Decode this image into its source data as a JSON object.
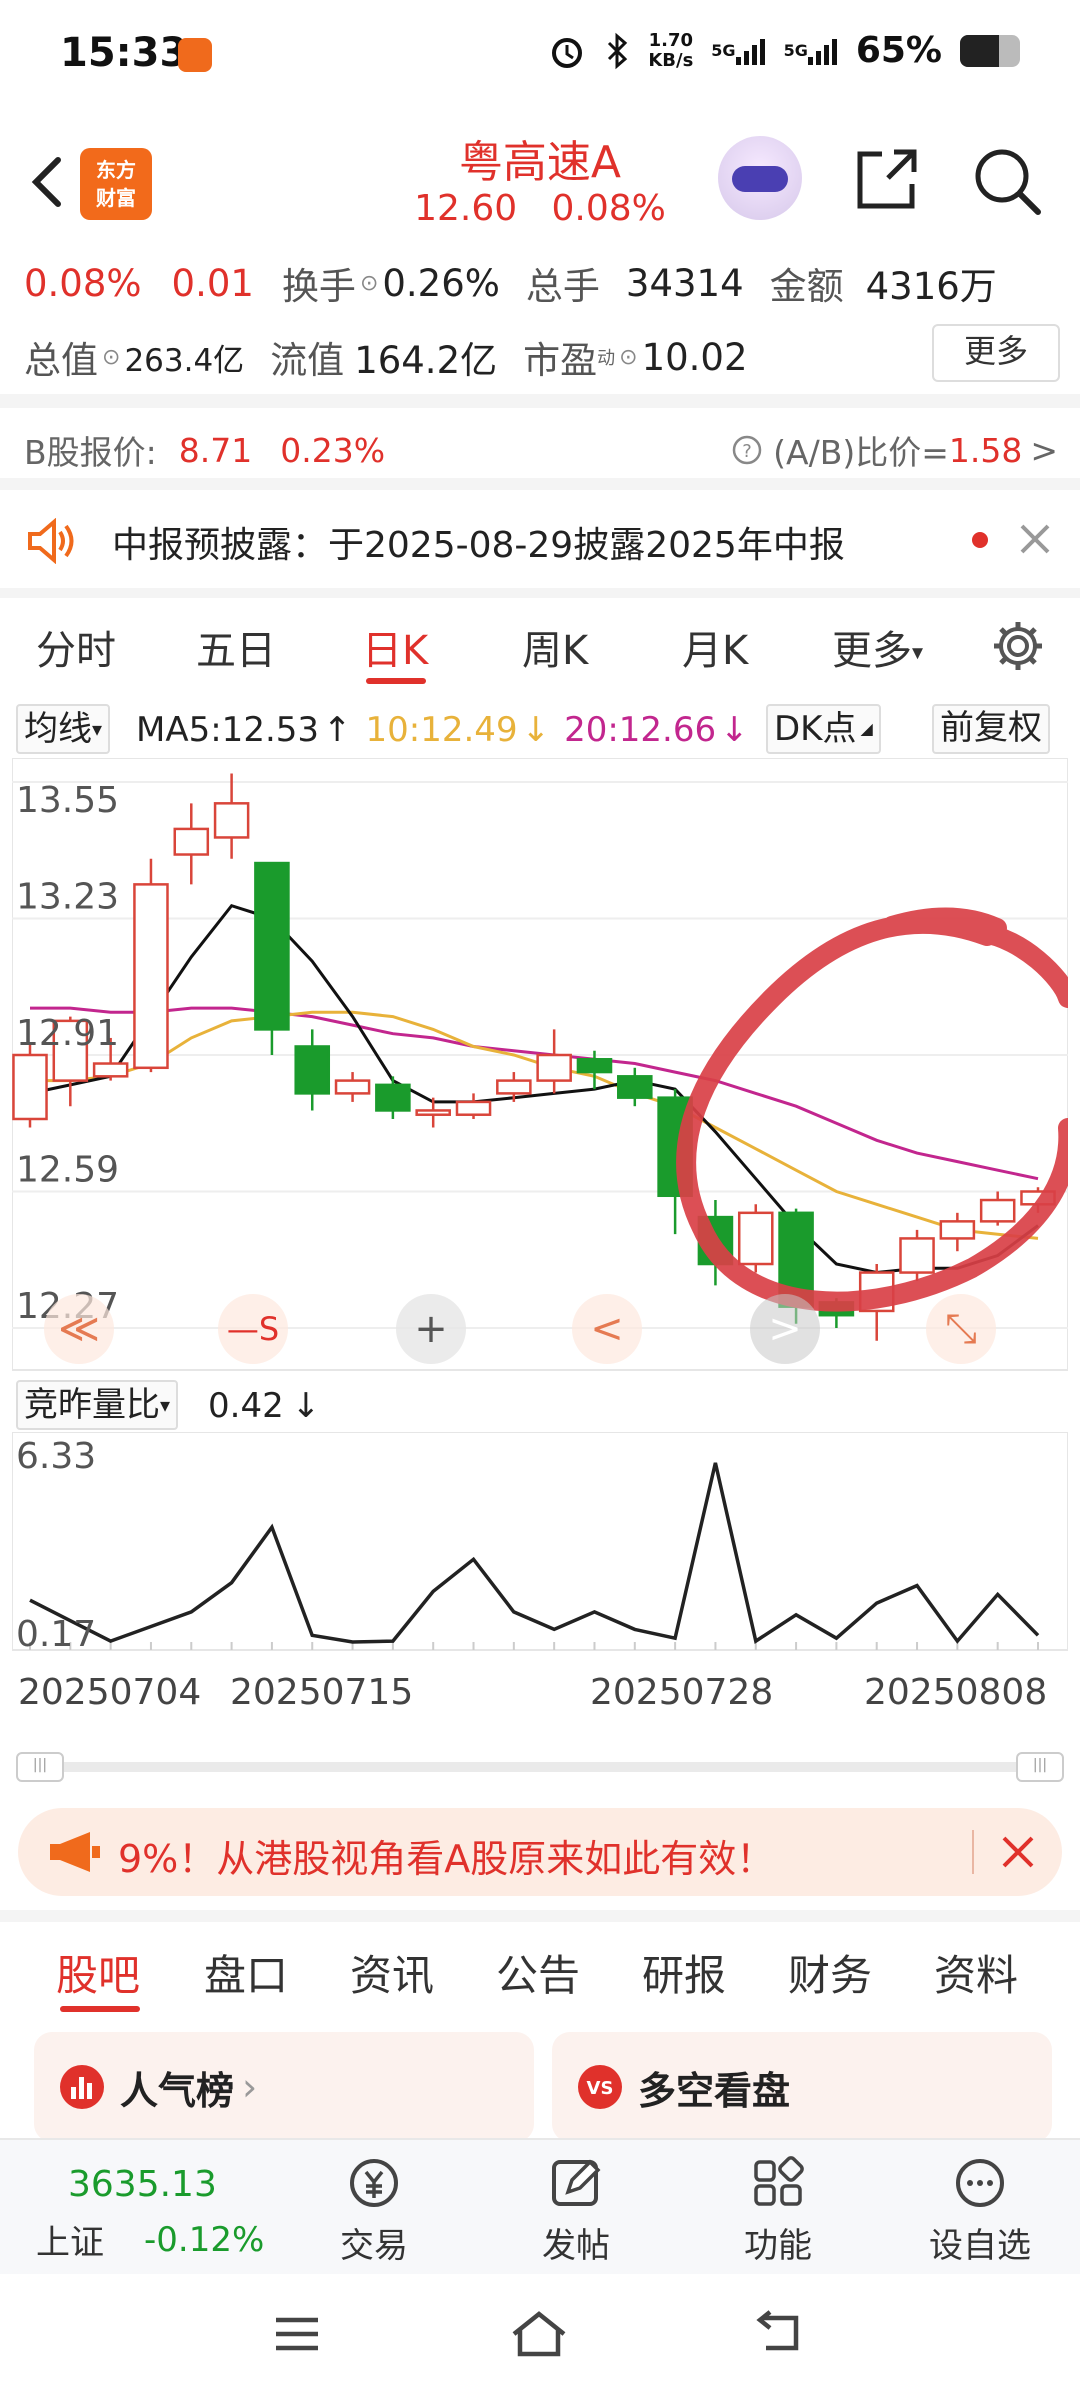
{
  "status_bar": {
    "time": "15:33",
    "net_speed_top": "1.70",
    "net_speed_unit": "KB/s",
    "signal1": "5G",
    "signal2": "5G",
    "battery": "65%",
    "battery_level": 0.65
  },
  "header": {
    "logo_line1": "东方",
    "logo_line2": "财富",
    "stock_name": "粤高速A",
    "price": "12.60",
    "change_pct": "0.08%"
  },
  "quote": {
    "change_pct": "0.08%",
    "change_amt": "0.01",
    "turnover_label": "换手",
    "turnover": "0.26%",
    "volume_label": "总手",
    "volume": "34314",
    "amount_label": "金额",
    "amount": "4316万",
    "total_cap_label": "总值",
    "total_cap": "263.4亿",
    "float_cap_label": "流值",
    "float_cap": "164.2亿",
    "pe_label": "市盈",
    "pe_sup": "动",
    "pe": "10.02",
    "more": "更多"
  },
  "b_share": {
    "label": "B股报价:",
    "price": "8.71",
    "pct": "0.23%",
    "ratio_label": "(A/B)比价=",
    "ratio": "1.58",
    "arrow": ">"
  },
  "notice": {
    "text": "中报预披露：于2025-08-29披露2025年中报"
  },
  "period_tabs": [
    "分时",
    "五日",
    "日K",
    "周K",
    "月K",
    "更多"
  ],
  "active_tab": "日K",
  "ma_bar": {
    "selector": "均线",
    "ma5": "MA5:12.53",
    "ma5_arrow": "↑",
    "ma10": "10:12.49",
    "ma10_arrow": "↓",
    "ma20": "20:12.66",
    "ma20_arrow": "↓",
    "dk": "DK点",
    "adjust": "前复权"
  },
  "chart_labels": {
    "y_ticks": [
      "13.55",
      "13.23",
      "12.91",
      "12.59",
      "12.27"
    ],
    "controls": [
      "≪",
      "—S",
      "+",
      "<",
      ">",
      "⤡"
    ]
  },
  "chart_data": {
    "type": "candlestick",
    "y_axis_ticks": [
      13.55,
      13.23,
      12.91,
      12.59,
      12.27
    ],
    "candles": [
      {
        "o": 12.76,
        "c": 12.91,
        "h": 12.94,
        "l": 12.74
      },
      {
        "o": 12.85,
        "c": 12.99,
        "h": 13.0,
        "l": 12.79
      },
      {
        "o": 12.86,
        "c": 12.89,
        "h": 12.95,
        "l": 12.85
      },
      {
        "o": 12.88,
        "c": 13.31,
        "h": 13.37,
        "l": 12.87
      },
      {
        "o": 13.38,
        "c": 13.44,
        "h": 13.5,
        "l": 13.31
      },
      {
        "o": 13.42,
        "c": 13.5,
        "h": 13.57,
        "l": 13.37
      },
      {
        "o": 13.36,
        "c": 12.97,
        "h": 13.36,
        "l": 12.91
      },
      {
        "o": 12.93,
        "c": 12.82,
        "h": 12.97,
        "l": 12.78
      },
      {
        "o": 12.82,
        "c": 12.85,
        "h": 12.87,
        "l": 12.8
      },
      {
        "o": 12.84,
        "c": 12.78,
        "h": 12.86,
        "l": 12.76
      },
      {
        "o": 12.77,
        "c": 12.78,
        "h": 12.81,
        "l": 12.74
      },
      {
        "o": 12.77,
        "c": 12.8,
        "h": 12.82,
        "l": 12.76
      },
      {
        "o": 12.82,
        "c": 12.85,
        "h": 12.87,
        "l": 12.8
      },
      {
        "o": 12.85,
        "c": 12.91,
        "h": 12.97,
        "l": 12.82
      },
      {
        "o": 12.9,
        "c": 12.87,
        "h": 12.92,
        "l": 12.83
      },
      {
        "o": 12.86,
        "c": 12.81,
        "h": 12.88,
        "l": 12.79
      },
      {
        "o": 12.81,
        "c": 12.58,
        "h": 12.83,
        "l": 12.49
      },
      {
        "o": 12.53,
        "c": 12.42,
        "h": 12.57,
        "l": 12.37
      },
      {
        "o": 12.42,
        "c": 12.54,
        "h": 12.56,
        "l": 12.4
      },
      {
        "o": 12.54,
        "c": 12.32,
        "h": 12.55,
        "l": 12.28
      },
      {
        "o": 12.33,
        "c": 12.3,
        "h": 12.34,
        "l": 12.27
      },
      {
        "o": 12.31,
        "c": 12.4,
        "h": 12.42,
        "l": 12.24
      },
      {
        "o": 12.4,
        "c": 12.48,
        "h": 12.5,
        "l": 12.38
      },
      {
        "o": 12.48,
        "c": 12.52,
        "h": 12.54,
        "l": 12.45
      },
      {
        "o": 12.52,
        "c": 12.57,
        "h": 12.59,
        "l": 12.51
      },
      {
        "o": 12.56,
        "c": 12.59,
        "h": 12.6,
        "l": 12.54
      }
    ],
    "ma5": [
      12.82,
      12.84,
      12.86,
      13.0,
      13.14,
      13.26,
      13.23,
      13.13,
      13.0,
      12.85,
      12.8,
      12.8,
      12.81,
      12.82,
      12.83,
      12.85,
      12.83,
      12.73,
      12.62,
      12.51,
      12.42,
      12.4,
      12.41,
      12.41,
      12.44,
      12.51
    ],
    "ma10": [
      12.85,
      12.85,
      12.86,
      12.89,
      12.95,
      12.99,
      13.0,
      13.01,
      13.01,
      13.0,
      12.97,
      12.93,
      12.91,
      12.88,
      12.86,
      12.82,
      12.79,
      12.74,
      12.69,
      12.64,
      12.59,
      12.56,
      12.53,
      12.5,
      12.49,
      12.48
    ],
    "ma20": [
      13.02,
      13.02,
      13.01,
      13.01,
      13.02,
      13.02,
      13.01,
      13.0,
      12.98,
      12.96,
      12.95,
      12.93,
      12.92,
      12.91,
      12.9,
      12.89,
      12.87,
      12.85,
      12.82,
      12.79,
      12.75,
      12.71,
      12.68,
      12.66,
      12.64,
      12.62
    ],
    "volume_ratio_ticks": [
      6.33,
      0.17
    ],
    "volume_ratio": [
      1.6,
      0.9,
      0.2,
      0.7,
      1.2,
      2.2,
      4.1,
      0.4,
      0.1,
      0.2,
      1.9,
      3.0,
      1.2,
      0.6,
      1.2,
      0.6,
      0.3,
      6.3,
      0.2,
      1.1,
      0.3,
      1.5,
      2.1,
      0.2,
      1.8,
      0.4
    ],
    "x_labels": [
      "20250704",
      "20250715",
      "20250728",
      "20250808"
    ]
  },
  "volume_bar": {
    "selector": "竞昨量比",
    "value": "0.42",
    "arrow": "↓",
    "y_top": "6.33",
    "y_bottom": "0.17"
  },
  "banner": {
    "text": "9%！从港股视角看A股原来如此有效！"
  },
  "sub_tabs": [
    "股吧",
    "盘口",
    "资讯",
    "公告",
    "研报",
    "财务",
    "资料"
  ],
  "active_sub_tab": "股吧",
  "cards": {
    "left": "人气榜",
    "right": "多空看盘"
  },
  "bottom_nav": {
    "index_value": "3635.13",
    "index_name": "上证",
    "index_change": "-0.12%",
    "items": [
      "交易",
      "发帖",
      "功能",
      "设自选"
    ]
  },
  "colors": {
    "red": "#e0312b",
    "green": "#1a9b2c",
    "brand_orange": "#f26a1b"
  }
}
